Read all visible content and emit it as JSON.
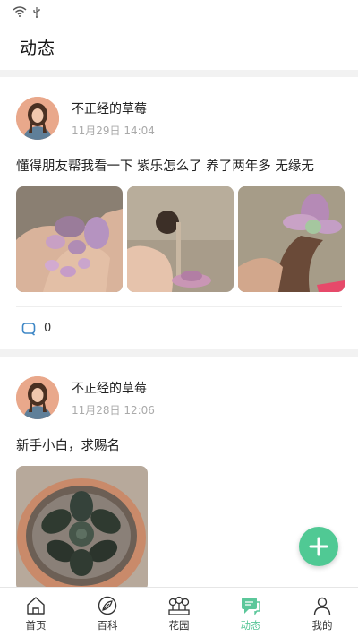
{
  "header": {
    "title": "动态"
  },
  "posts": [
    {
      "author": "不正经的草莓",
      "time": "11月29日 14:04",
      "text": "懂得朋友帮我看一下 紫乐怎么了 养了两年多 无缘无",
      "comment_count": "0"
    },
    {
      "author": "不正经的草莓",
      "time": "11月28日 12:06",
      "text": "新手小白，求赐名"
    }
  ],
  "tabs": [
    {
      "label": "首页",
      "icon": "home-icon"
    },
    {
      "label": "百科",
      "icon": "encyclopedia-icon"
    },
    {
      "label": "花园",
      "icon": "garden-icon"
    },
    {
      "label": "动态",
      "icon": "feed-icon"
    },
    {
      "label": "我的",
      "icon": "profile-icon"
    }
  ],
  "colors": {
    "accent": "#5bc79a",
    "fab": "#50c994"
  }
}
